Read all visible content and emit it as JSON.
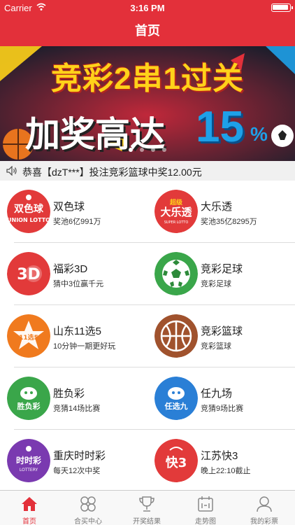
{
  "status_bar": {
    "carrier": "Carrier",
    "time": "3:16 PM"
  },
  "nav": {
    "title": "首页"
  },
  "banner": {
    "line1": "竞彩2串1过关",
    "line2": "加奖高达",
    "percent": "15",
    "percent_sign": "%",
    "pages": 4,
    "active_page": 0
  },
  "notice": {
    "text": "恭喜【dzT***】投注竞彩篮球中奖12.00元",
    "icon": "speaker-icon"
  },
  "lotteries": [
    {
      "name": "双色球",
      "desc": "奖池6亿991万",
      "icon": "double-color-ball-icon",
      "color": "#e23a3a"
    },
    {
      "name": "大乐透",
      "desc": "奖池35亿8295万",
      "icon": "super-lotto-icon",
      "color": "#e23a3a"
    },
    {
      "name": "福彩3D",
      "desc": "猜中3位赢千元",
      "icon": "welfare-3d-icon",
      "color": "#e23a3a"
    },
    {
      "name": "竞彩足球",
      "desc": "竞彩足球",
      "icon": "football-icon",
      "color": "#3aa64a"
    },
    {
      "name": "山东11选5",
      "desc": "10分钟一期更好玩",
      "icon": "shandong-11x5-icon",
      "color": "#f07a1e"
    },
    {
      "name": "竞彩篮球",
      "desc": "竞彩篮球",
      "icon": "basketball-icon",
      "color": "#a0522d"
    },
    {
      "name": "胜负彩",
      "desc": "竞猜14场比赛",
      "icon": "win-lose-icon",
      "color": "#3aa64a"
    },
    {
      "name": "任九场",
      "desc": "竞猜9场比赛",
      "icon": "any-nine-icon",
      "color": "#2a7fd6"
    },
    {
      "name": "重庆时时彩",
      "desc": "每天12次中奖",
      "icon": "chongqing-ssc-icon",
      "color": "#7a3ab0"
    },
    {
      "name": "江苏快3",
      "desc": "晚上22:10截止",
      "icon": "jiangsu-k3-icon",
      "color": "#e23a3a"
    }
  ],
  "logo_texts": {
    "ssq_top": "双色球",
    "ssq_bottom": "UNION LOTTO",
    "dlt_top": "超级",
    "dlt_main": "大乐透",
    "dlt_sub": "SUPER LOTTO",
    "fc3d": "3D",
    "sd11x5": "11选5",
    "sfc": "胜负彩",
    "r9": "任选九",
    "ssc": "时时彩",
    "ssc_sub": "LOTTERY",
    "k3": "快3"
  },
  "tabs": [
    {
      "label": "首页",
      "icon": "home-icon",
      "active": true
    },
    {
      "label": "合买中心",
      "icon": "joint-purchase-icon",
      "active": false
    },
    {
      "label": "开奖结果",
      "icon": "trophy-icon",
      "active": false
    },
    {
      "label": "走势图",
      "icon": "trend-chart-icon",
      "active": false
    },
    {
      "label": "我的彩票",
      "icon": "profile-icon",
      "active": false
    }
  ],
  "colors": {
    "brand_red": "#e3303a",
    "tab_inactive": "#777777"
  }
}
